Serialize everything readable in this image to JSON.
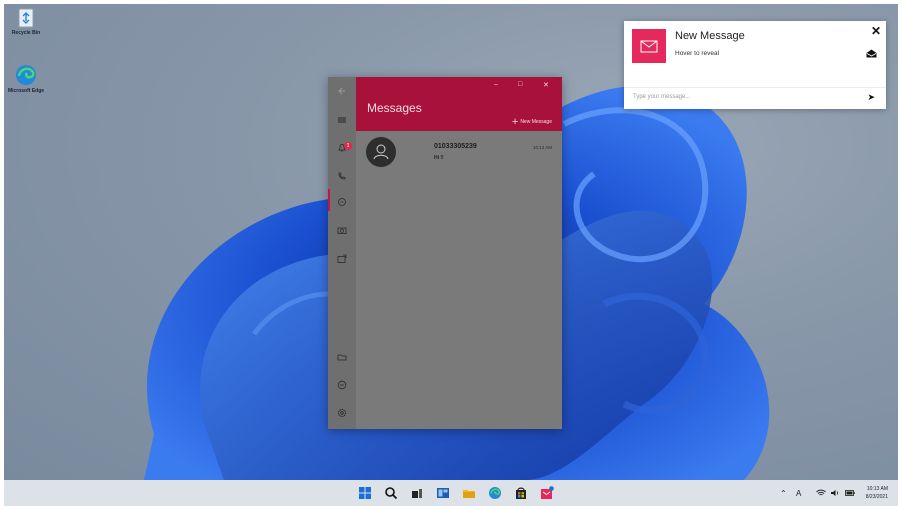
{
  "desktop": {
    "icons": [
      {
        "label": "Recycle Bin"
      },
      {
        "label": "Microsoft Edge"
      }
    ]
  },
  "app": {
    "title": "Messages",
    "new_message_label": "New Message",
    "notification_count": "1",
    "conversations": [
      {
        "name": "01033305239",
        "snippet": "Hi !!",
        "time": "10:13 AM"
      }
    ]
  },
  "toast": {
    "title": "New Message",
    "subtitle": "Hover to reveal",
    "reply_placeholder": "Type your message...",
    "accent_color": "#e5295c"
  },
  "taskbar": {
    "clock_time": "10:13 AM",
    "clock_date": "8/23/2021",
    "input_indicator": "A"
  },
  "colors": {
    "header": "#a8123a",
    "accent": "#c4173f"
  }
}
